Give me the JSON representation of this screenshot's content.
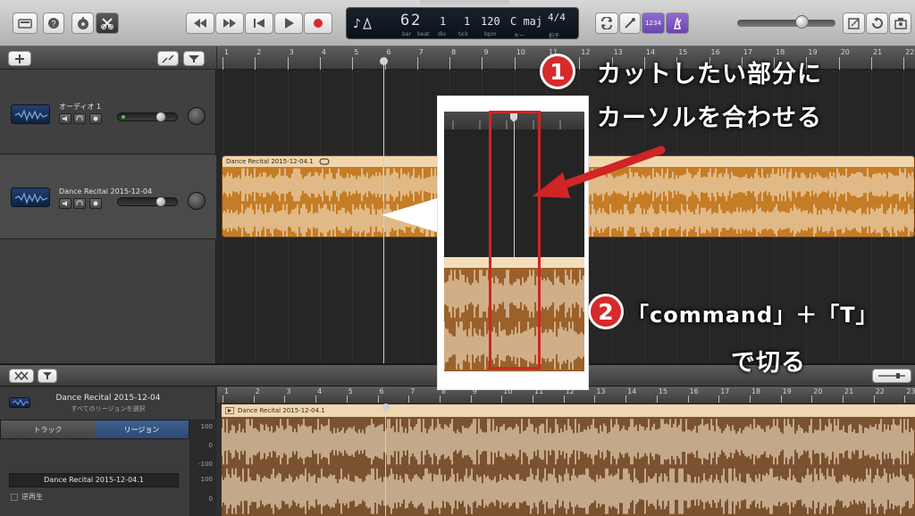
{
  "lcd": {
    "bar": "6",
    "beat": "2",
    "div": "1",
    "tick": "1",
    "bpm": "120",
    "key": "C maj",
    "time_sig": "4/4",
    "labels": {
      "bar": "bar",
      "beat": "beat",
      "div": "div",
      "tick": "tick",
      "bpm": "bpm",
      "key": "キー",
      "sig": "拍子"
    },
    "toggle": "1234"
  },
  "tracks": [
    {
      "name": "オーディオ 1"
    },
    {
      "name": "Dance Recital 2015-12-04"
    }
  ],
  "region": {
    "name": "Dance Recital 2015-12-04.1"
  },
  "ruler": {
    "numbers": [
      "1",
      "2",
      "3",
      "4",
      "5",
      "6",
      "7",
      "8",
      "9",
      "10",
      "11",
      "12",
      "13",
      "14",
      "15",
      "16",
      "17",
      "18",
      "19",
      "20",
      "21",
      "22",
      "23"
    ]
  },
  "editor": {
    "track_name": "Dance Recital 2015-12-04",
    "subtitle": "すべてのリージョンを選択",
    "tab_track": "トラック",
    "tab_region": "リージョン",
    "region_name": "Dance Recital 2015-12-04.1",
    "reverse_label": "逆再生",
    "db": [
      "100",
      "0",
      "-100",
      "100",
      "0"
    ]
  },
  "annotations": {
    "step1_number": "1",
    "step1_line1": "カットしたい部分に",
    "step1_line2": "カーソルを合わせる",
    "step2_number": "2",
    "step2_line1": "「command」＋「T」",
    "step2_line2": "で切る"
  },
  "colors": {
    "region_orange": "#c47c26",
    "annotation_red": "#d72a2a",
    "lcd_background": "#0c1118"
  },
  "icons": {
    "toolbar": [
      "library-icon",
      "help-icon",
      "smart-controls-icon",
      "editors-icon",
      "rewind-icon",
      "fast-forward-icon",
      "go-to-start-icon",
      "play-icon",
      "record-icon",
      "cycle-icon",
      "tuner-icon",
      "count-in-icon",
      "metronome-icon",
      "notepad-icon",
      "loop-browser-icon",
      "media-browser-icon"
    ]
  }
}
